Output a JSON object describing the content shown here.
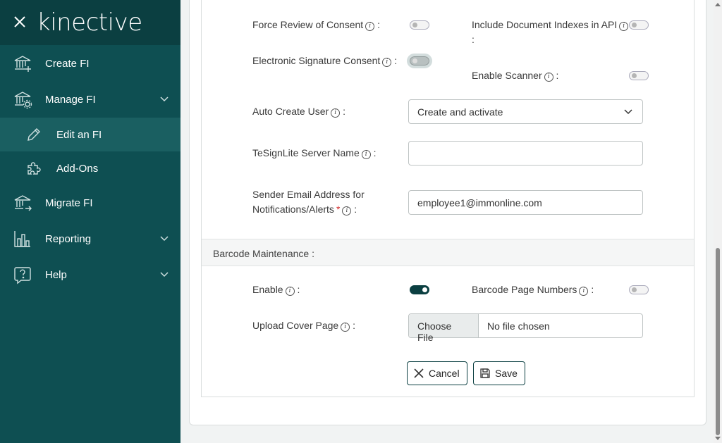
{
  "sidebar": {
    "brand": "kinective",
    "items": [
      {
        "label": "Create FI",
        "icon": "bank-plus-icon"
      },
      {
        "label": "Manage FI",
        "icon": "bank-gear-icon"
      },
      {
        "label": "Edit an FI",
        "icon": "pencil-icon"
      },
      {
        "label": "Add-Ons",
        "icon": "puzzle-icon"
      },
      {
        "label": "Migrate FI",
        "icon": "bank-arrow-icon"
      },
      {
        "label": "Reporting",
        "icon": "bar-chart-icon"
      },
      {
        "label": "Help",
        "icon": "help-bubble-icon"
      }
    ]
  },
  "form": {
    "force_review_label": "Force Review of Consent",
    "include_indexes_label": "Include Document Indexes in API",
    "esig_consent_label": "Electronic Signature Consent",
    "enable_scanner_label": "Enable Scanner",
    "auto_create_user_label": "Auto Create User",
    "auto_create_user_value": "Create and activate",
    "tesign_label": "TeSignLite Server Name",
    "tesign_value": "",
    "sender_email_label_line1": "Sender Email Address for",
    "sender_email_label_line2": "Notifications/Alerts",
    "sender_email_value": "employee1@immonline.com",
    "barcode_section_title": "Barcode Maintenance :",
    "enable_label": "Enable",
    "barcode_page_numbers_label": "Barcode Page Numbers",
    "upload_cover_label": "Upload Cover Page",
    "choose_file_label": "Choose File",
    "no_file_text": "No file chosen",
    "cancel_label": "Cancel",
    "save_label": "Save",
    "colon": ":",
    "info_glyph": "i",
    "required_mark": "*"
  },
  "colors": {
    "sidebar_bg": "#0e4f52",
    "sidebar_header": "#0b3f41",
    "accent": "#0b3f41",
    "required": "#d32f2f"
  },
  "toggles": {
    "force_review": false,
    "include_indexes": false,
    "esig_consent": false,
    "enable_scanner": false,
    "barcode_enable": true,
    "barcode_page_numbers": false
  }
}
